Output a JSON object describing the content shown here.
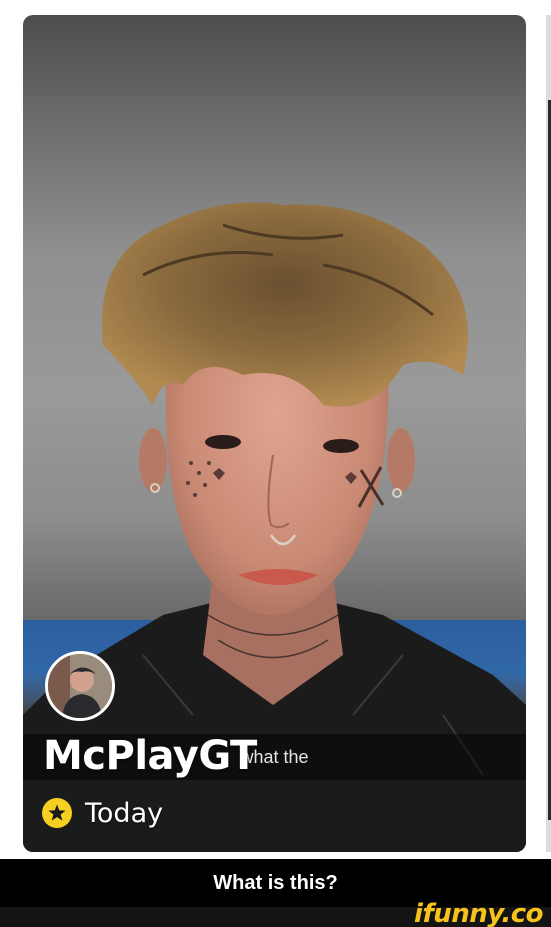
{
  "story": {
    "username": "McPlayGT",
    "time_label": "Today",
    "caption": "what the"
  },
  "post": {
    "title": "What is this?"
  },
  "brand": {
    "watermark": "ifunny.co",
    "watermark_color": "#f7c31a"
  },
  "icons": {
    "badge": "star-badge-icon",
    "avatar": "profile-avatar"
  }
}
